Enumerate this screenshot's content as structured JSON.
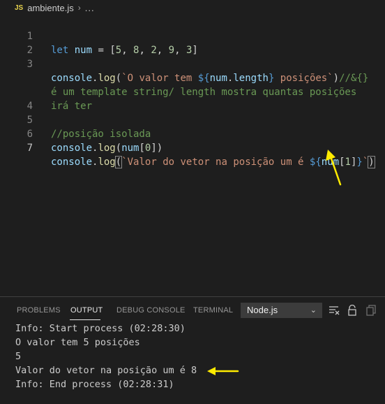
{
  "breadcrumb": {
    "file_badge": "JS",
    "file_name": "ambiente.js",
    "separator": "›",
    "more": "..."
  },
  "editor": {
    "lines": [
      {
        "n": "1"
      },
      {
        "n": "2"
      },
      {
        "n": "3"
      },
      {
        "n": ""
      },
      {
        "n": ""
      },
      {
        "n": "4"
      },
      {
        "n": "5"
      },
      {
        "n": "6"
      },
      {
        "n": "7"
      }
    ],
    "code": {
      "l1_kw": "let",
      "l1_var": "num",
      "l1_rest": " = [",
      "l1_vals": [
        "5",
        "8",
        "2",
        "9",
        "3"
      ],
      "l3_obj": "console",
      "l3_fn": "log",
      "l3_str1": "`O valor tem ",
      "l3_tpl_open": "${",
      "l3_var": "num",
      "l3_prop": "length",
      "l3_tpl_close": "}",
      "l3_str2": " posições`",
      "l3_comment": "//&{}",
      "l3b_comment": "é um template string/ length mostra quantas posições",
      "l3c_comment": "irá ter",
      "l5_comment": "//posição isolada",
      "l6_obj": "console",
      "l6_fn": "log",
      "l6_var": "num",
      "l6_idx": "0",
      "l7_obj": "console",
      "l7_fn": "log",
      "l7_str": "`Valor do vetor na posição um é ",
      "l7_tpl_open": "${",
      "l7_var": "num",
      "l7_idx": "1",
      "l7_tpl_close": "}",
      "l7_str_end": "`"
    }
  },
  "panel": {
    "tabs": [
      "PROBLEMS",
      "OUTPUT",
      "DEBUG CONSOLE",
      "TERMINAL"
    ],
    "active_tab": "OUTPUT",
    "selected_channel": "Node.js",
    "output_lines": [
      "Info: Start process (02:28:30)",
      "O valor tem 5 posições",
      "5",
      "Valor do vetor na posição um é 8",
      "Info: End process (02:28:31)"
    ]
  },
  "colors": {
    "annotation_arrow": "#ffeb00",
    "background": "#1e1e1e"
  },
  "icons": [
    "chevron-down-icon",
    "clear-output-icon",
    "lock-scroll-icon",
    "copy-icon"
  ]
}
